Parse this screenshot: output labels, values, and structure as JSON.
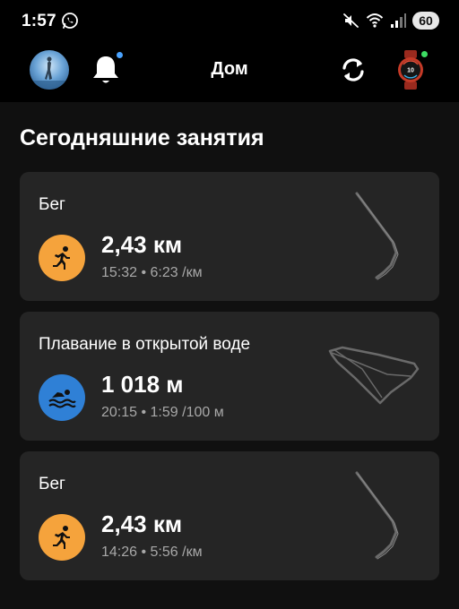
{
  "status_bar": {
    "time": "1:57",
    "battery": "60",
    "icons": [
      "whatsapp-icon",
      "mute-icon",
      "wifi-icon",
      "signal-icon",
      "battery-icon"
    ]
  },
  "header": {
    "title": "Дом",
    "icons": [
      "avatar",
      "bell-icon",
      "sync-icon",
      "watch-icon"
    ],
    "notification_dot_color": "#4aa3ff",
    "watch_connected_dot_color": "#3ddc63"
  },
  "main": {
    "section_title": "Сегодняшние занятия",
    "activities": [
      {
        "name": "Бег",
        "type_icon": "running-icon",
        "icon_color": "#f5a33c",
        "value": "2,43 км",
        "details": "15:32 • 6:23 /км"
      },
      {
        "name": "Плавание в открытой воде",
        "type_icon": "swimming-icon",
        "icon_color": "#2f80d6",
        "value": "1 018 м",
        "details": "20:15 • 1:59 /100 м"
      },
      {
        "name": "Бег",
        "type_icon": "running-icon",
        "icon_color": "#f5a33c",
        "value": "2,43 км",
        "details": "14:26 • 5:56 /км"
      }
    ]
  }
}
